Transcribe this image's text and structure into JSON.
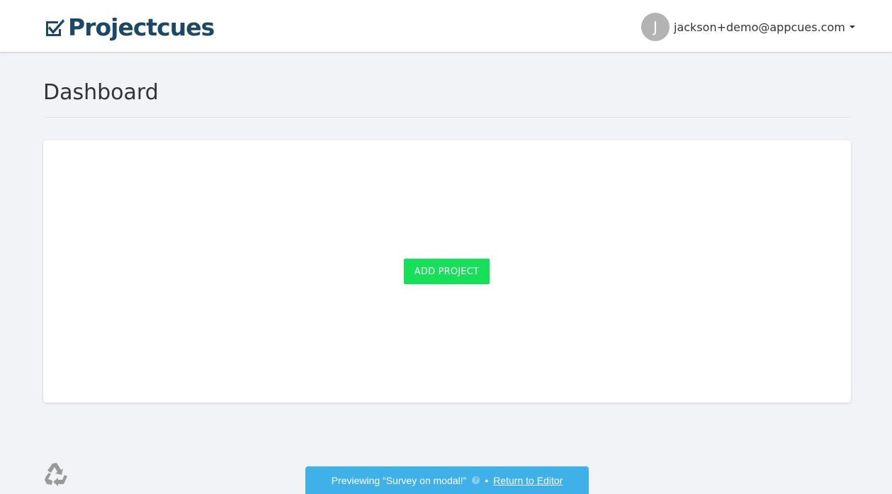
{
  "header": {
    "logo_text": "Projectcues",
    "user": {
      "avatar_initial": "J",
      "email": "jackson+demo@appcues.com"
    }
  },
  "main": {
    "page_title": "Dashboard",
    "add_project_label": "ADD PROJECT"
  },
  "preview_bar": {
    "message": "Previewing “Survey on modal!”",
    "help_glyph": "?",
    "separator": "•",
    "return_label": "Return to Editor"
  },
  "colors": {
    "brand": "#1c4866",
    "accent_green": "#16e05a",
    "preview_blue": "#3fb0e8",
    "background": "#f2f3f7"
  },
  "icons": {
    "logo": "checkbox-check-icon",
    "footer": "recycle-icon",
    "menu": "caret-down-icon",
    "help": "help-circle-icon"
  }
}
